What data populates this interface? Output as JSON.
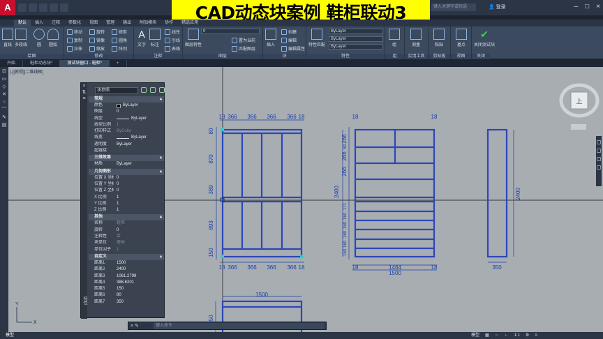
{
  "banner": "CAD动态块案例 鞋柜联动3",
  "titlebar": {
    "search_placeholder": "键入关键字或短语",
    "user": "登录"
  },
  "ribbon_tabs": [
    "默认",
    "插入",
    "注释",
    "参数化",
    "视图",
    "管理",
    "输出",
    "附加模块",
    "协作",
    "精选应用"
  ],
  "ribbon": {
    "draw": {
      "label": "绘图",
      "line": "直线",
      "polyline": "多段线",
      "circle": "圆",
      "arc": "圆弧"
    },
    "modify": {
      "label": "修改",
      "move": "移动",
      "rotate": "旋转",
      "trim": "修剪",
      "copy": "复制",
      "mirror": "镜像",
      "fillet": "圆角",
      "stretch": "拉伸",
      "scale": "缩放",
      "array": "阵列"
    },
    "annotation": {
      "label": "注释",
      "text": "文字",
      "dimension": "标注",
      "linear": "线性",
      "leader": "引线",
      "table": "表格"
    },
    "layers": {
      "label": "图层",
      "layer_props": "图层特性",
      "current": "0",
      "make_current": "置为当前",
      "match": "匹配图层"
    },
    "block": {
      "label": "块",
      "insert": "插入",
      "create": "创建",
      "edit": "编辑",
      "edit_attr": "编辑属性"
    },
    "properties": {
      "label": "特性",
      "match_props": "特性匹配",
      "color": "ByLayer",
      "linetype": "ByLayer",
      "lineweight": "ByLayer"
    },
    "groups": {
      "label": "组",
      "group": "组"
    },
    "utilities": {
      "label": "实用工具",
      "measure": "测量"
    },
    "clipboard": {
      "label": "剪贴板",
      "paste": "粘贴"
    },
    "view": {
      "label": "视图",
      "base": "基点"
    },
    "close": {
      "label": "关闭",
      "close_test": "关闭测试块"
    }
  },
  "doc_tabs": [
    "开始",
    "鞋柜动态块*",
    "测试块窗口 - 鞋柜*"
  ],
  "viewport_label": "[-][俯视][二维线框]",
  "properties": {
    "selector": "块参照",
    "vertical_title": "特性",
    "sections": [
      {
        "title": "常规",
        "rows": [
          {
            "k": "颜色",
            "v": "ByLayer",
            "kind": "swatch"
          },
          {
            "k": "图层",
            "v": "0"
          },
          {
            "k": "线型",
            "v": "ByLayer",
            "kind": "line"
          },
          {
            "k": "线型比例",
            "v": "1",
            "dim": true
          },
          {
            "k": "打印样式",
            "v": "ByColor",
            "dim": true
          },
          {
            "k": "线宽",
            "v": "ByLayer",
            "kind": "line"
          },
          {
            "k": "透明度",
            "v": "ByLayer"
          },
          {
            "k": "超链接",
            "v": ""
          }
        ]
      },
      {
        "title": "三维效果",
        "rows": [
          {
            "k": "材质",
            "v": "ByLayer"
          }
        ]
      },
      {
        "title": "几何图形",
        "rows": [
          {
            "k": "位置 X 坐标",
            "v": "0"
          },
          {
            "k": "位置 Y 坐标",
            "v": "0"
          },
          {
            "k": "位置 Z 坐标",
            "v": "0"
          },
          {
            "k": "X 比例",
            "v": "1"
          },
          {
            "k": "Y 比例",
            "v": "1"
          },
          {
            "k": "Z 比例",
            "v": "1"
          }
        ]
      },
      {
        "title": "其他",
        "rows": [
          {
            "k": "名称",
            "v": "鞋柜",
            "dim": true
          },
          {
            "k": "旋转",
            "v": "0"
          },
          {
            "k": "注释性",
            "v": "否",
            "dim": true
          },
          {
            "k": "块单位",
            "v": "毫米",
            "dim": true
          },
          {
            "k": "单位因子",
            "v": "1",
            "dim": true
          }
        ]
      },
      {
        "title": "自定义",
        "rows": [
          {
            "k": "距离1",
            "v": "1500"
          },
          {
            "k": "距离2",
            "v": "2400"
          },
          {
            "k": "距离3",
            "v": "1061.2799"
          },
          {
            "k": "距离4",
            "v": "388.6201"
          },
          {
            "k": "距离5",
            "v": "150"
          },
          {
            "k": "距离6",
            "v": "80"
          },
          {
            "k": "距离7",
            "v": "350"
          }
        ]
      }
    ]
  },
  "drawing": {
    "front_top_dims": [
      "18",
      "366",
      "366",
      "366",
      "366",
      "18"
    ],
    "front_bottom_dims": [
      "18",
      "366",
      "366",
      "366",
      "366",
      "18"
    ],
    "front_left_dims": [
      "80",
      "870",
      "389",
      "893",
      "150"
    ],
    "side_top_dims": [
      "18",
      "18"
    ],
    "side_left_dims": [
      "266",
      "80",
      "266",
      "266",
      "171",
      "160",
      "160",
      "160",
      "160",
      "150"
    ],
    "side_height": "2400",
    "side_bottom_inner": "1464",
    "side_bottom_total": "1500",
    "side_bottom_edges": [
      "18",
      "18"
    ],
    "section_height": "2400",
    "section_width": "350",
    "plan_width": "1500",
    "plan_depth": "350"
  },
  "command_line": {
    "placeholder": "键入命令"
  },
  "statusbar": {
    "model_tab": "模型",
    "right": [
      "模型",
      "1:1"
    ]
  },
  "viewcube": {
    "face": "上"
  },
  "colors": {
    "canvas": "#a8adb2",
    "geometry": "#2c47b8",
    "dims": "#1a3ea8"
  }
}
